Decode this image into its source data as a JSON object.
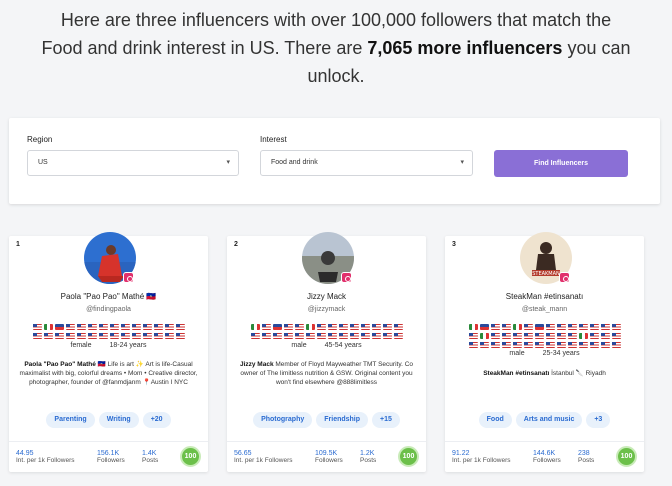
{
  "headline": {
    "line1": "Here are three influencers with over 100,000 followers that match the",
    "line2_pre": "Food and drink interest in US. There are ",
    "line2_bold": "7,065 more influencers",
    "line2_post": " you can",
    "line3": "unlock."
  },
  "search": {
    "region_label": "Region",
    "region_value": "US",
    "interest_label": "Interest",
    "interest_value": "Food and drink",
    "button_label": "Find Influencers"
  },
  "cards": [
    {
      "rank": "1",
      "name": "Paola \"Pao Pao\" Mathé 🇭🇹",
      "handle": "@findingpaola",
      "gender": "female",
      "age": "18-24 years",
      "bio_name": "Paola \"Pao Pao\" Mathé 🇭🇹",
      "bio_text": " Life is art ✨ Art is life-Casual maximalist with big, colorful dreams • Mom • Creative director, photographer, founder of @fanmdjanm 📍Austin I NYC",
      "tags": [
        "Parenting",
        "Writing",
        "+20"
      ],
      "stats": [
        {
          "value": "44.95",
          "label": "Int. per 1k Followers"
        },
        {
          "value": "156.1K",
          "label": "Followers"
        },
        {
          "value": "1.4K",
          "label": "Posts"
        }
      ],
      "score": "100"
    },
    {
      "rank": "2",
      "name": "Jizzy Mack",
      "handle": "@jizzymack",
      "gender": "male",
      "age": "45-54 years",
      "bio_name": "Jizzy Mack",
      "bio_text": " Member of Floyd Mayweather TMT Security. Co owner of The limitless nutrition & GSW. Original content you won't find elsewhere @888limitless",
      "tags": [
        "Photography",
        "Friendship",
        "+15"
      ],
      "stats": [
        {
          "value": "56.65",
          "label": "Int. per 1k Followers"
        },
        {
          "value": "109.5K",
          "label": "Followers"
        },
        {
          "value": "1.2K",
          "label": "Posts"
        }
      ],
      "score": "100"
    },
    {
      "rank": "3",
      "name": "SteakMan #etinsanatı",
      "handle": "@steak_mann",
      "gender": "male",
      "age": "25-34 years",
      "bio_name": "SteakMan #etinsanatı",
      "bio_text": " İstanbul 🔪 Riyadh",
      "tags": [
        "Food",
        "Arts and music",
        "+3"
      ],
      "stats": [
        {
          "value": "91.22",
          "label": "Int. per 1k Followers"
        },
        {
          "value": "144.6K",
          "label": "Followers"
        },
        {
          "value": "238",
          "label": "Posts"
        }
      ],
      "score": "100"
    }
  ]
}
